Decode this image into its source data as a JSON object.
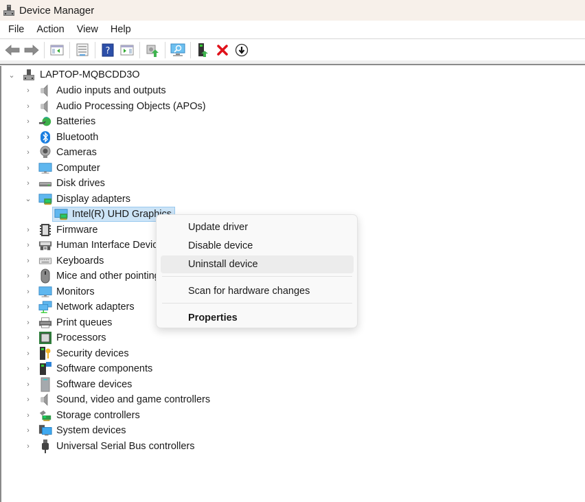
{
  "window": {
    "title": "Device Manager",
    "app_icon": "device-manager-icon"
  },
  "menubar": {
    "items": [
      "File",
      "Action",
      "View",
      "Help"
    ]
  },
  "toolbar": {
    "buttons": [
      {
        "name": "back-button",
        "icon": "arrow-left-icon"
      },
      {
        "name": "forward-button",
        "icon": "arrow-right-icon"
      },
      {
        "name": "show-hide-console-tree-button",
        "icon": "console-tree-icon"
      },
      {
        "name": "properties-button",
        "icon": "properties-sheet-icon"
      },
      {
        "name": "help-button",
        "icon": "help-icon"
      },
      {
        "name": "show-action-pane-button",
        "icon": "action-pane-icon"
      },
      {
        "name": "update-driver-button",
        "icon": "update-driver-icon"
      },
      {
        "name": "scan-hardware-button",
        "icon": "scan-monitor-icon"
      },
      {
        "name": "enable-device-button",
        "icon": "enable-device-icon"
      },
      {
        "name": "uninstall-device-button",
        "icon": "red-x-icon"
      },
      {
        "name": "disable-device-button",
        "icon": "down-arrow-circle-icon"
      }
    ]
  },
  "tree": {
    "root": {
      "label": "LAPTOP-MQBCDD3O",
      "expanded": true,
      "icon": "computer-tower-icon"
    },
    "categories": [
      {
        "label": "Audio inputs and outputs",
        "icon": "speaker-icon",
        "expanded": false
      },
      {
        "label": "Audio Processing Objects (APOs)",
        "icon": "speaker-icon",
        "expanded": false
      },
      {
        "label": "Batteries",
        "icon": "battery-icon",
        "expanded": false
      },
      {
        "label": "Bluetooth",
        "icon": "bluetooth-icon",
        "expanded": false
      },
      {
        "label": "Cameras",
        "icon": "camera-icon",
        "expanded": false
      },
      {
        "label": "Computer",
        "icon": "monitor-icon",
        "expanded": false
      },
      {
        "label": "Disk drives",
        "icon": "disk-drive-icon",
        "expanded": false
      },
      {
        "label": "Display adapters",
        "icon": "display-adapter-icon",
        "expanded": true,
        "children": [
          {
            "label": "Intel(R) UHD Graphics",
            "icon": "display-adapter-icon",
            "selected": true
          }
        ]
      },
      {
        "label": "Firmware",
        "icon": "chip-icon",
        "expanded": false
      },
      {
        "label": "Human Interface Devices",
        "icon": "hid-icon",
        "expanded": false
      },
      {
        "label": "Keyboards",
        "icon": "keyboard-icon",
        "expanded": false
      },
      {
        "label": "Mice and other pointing devices",
        "icon": "mouse-icon",
        "expanded": false
      },
      {
        "label": "Monitors",
        "icon": "monitor-icon",
        "expanded": false
      },
      {
        "label": "Network adapters",
        "icon": "network-icon",
        "expanded": false
      },
      {
        "label": "Print queues",
        "icon": "printer-icon",
        "expanded": false
      },
      {
        "label": "Processors",
        "icon": "processor-icon",
        "expanded": false
      },
      {
        "label": "Security devices",
        "icon": "security-key-icon",
        "expanded": false
      },
      {
        "label": "Software components",
        "icon": "software-component-icon",
        "expanded": false
      },
      {
        "label": "Software devices",
        "icon": "software-device-icon",
        "expanded": false
      },
      {
        "label": "Sound, video and game controllers",
        "icon": "speaker-icon",
        "expanded": false
      },
      {
        "label": "Storage controllers",
        "icon": "storage-controller-icon",
        "expanded": false
      },
      {
        "label": "System devices",
        "icon": "system-devices-icon",
        "expanded": false
      },
      {
        "label": "Universal Serial Bus controllers",
        "icon": "usb-icon",
        "expanded": false
      }
    ]
  },
  "context_menu": {
    "items": [
      {
        "label": "Update driver",
        "hover": false,
        "bold": false
      },
      {
        "label": "Disable device",
        "hover": false,
        "bold": false
      },
      {
        "label": "Uninstall device",
        "hover": true,
        "bold": false
      },
      {
        "label": "Scan for hardware changes",
        "hover": false,
        "bold": false
      },
      {
        "label": "Properties",
        "hover": false,
        "bold": true
      }
    ]
  },
  "colors": {
    "titlebar_bg": "#f7f0ea",
    "selection_bg": "#cce4f7",
    "selection_border": "#99c9ef",
    "menu_hover": "#ececec",
    "uninstall_red": "#e0121b"
  }
}
